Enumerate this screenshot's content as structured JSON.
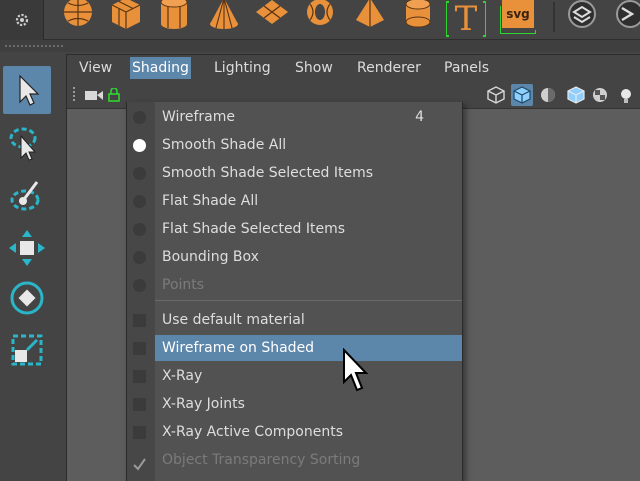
{
  "shelf": {
    "icons": [
      "sphere-icon",
      "cube-icon",
      "cylinder-icon",
      "cone-icon",
      "plane-icon",
      "torus-icon",
      "pyramid-icon",
      "disc-icon",
      "text-tool-icon",
      "svg-tool-icon",
      "sculpt-brush-icon",
      "nurbs-sphere-icon"
    ],
    "text_tool_glyph": "T",
    "svg_label": "svg",
    "accent_orange": "#e8913a",
    "accent_green": "#2fd52f"
  },
  "panel_menu": {
    "items": [
      "View",
      "Shading",
      "Lighting",
      "Show",
      "Renderer",
      "Panels"
    ],
    "open_index": 1
  },
  "shading_menu": {
    "items": [
      {
        "label": "Wireframe",
        "hotkey": "4",
        "mark": "radio",
        "checked": false,
        "disabled": false
      },
      {
        "label": "Smooth Shade All",
        "hotkey": "",
        "mark": "radio",
        "checked": true,
        "disabled": false
      },
      {
        "label": "Smooth Shade Selected Items",
        "hotkey": "",
        "mark": "radio",
        "checked": false,
        "disabled": false
      },
      {
        "label": "Flat Shade All",
        "hotkey": "",
        "mark": "radio",
        "checked": false,
        "disabled": false
      },
      {
        "label": "Flat Shade Selected Items",
        "hotkey": "",
        "mark": "radio",
        "checked": false,
        "disabled": false
      },
      {
        "label": "Bounding Box",
        "hotkey": "",
        "mark": "radio",
        "checked": false,
        "disabled": false
      },
      {
        "label": "Points",
        "hotkey": "",
        "mark": "radio",
        "checked": false,
        "disabled": true
      },
      {
        "label": "Use default material",
        "hotkey": "",
        "mark": "check",
        "checked": false,
        "disabled": false
      },
      {
        "label": "Wireframe on Shaded",
        "hotkey": "",
        "mark": "check",
        "checked": false,
        "disabled": false,
        "highlighted": true
      },
      {
        "label": "X-Ray",
        "hotkey": "",
        "mark": "check",
        "checked": false,
        "disabled": false
      },
      {
        "label": "X-Ray Joints",
        "hotkey": "",
        "mark": "check",
        "checked": false,
        "disabled": false
      },
      {
        "label": "X-Ray Active Components",
        "hotkey": "",
        "mark": "check",
        "checked": false,
        "disabled": false
      },
      {
        "label": "Object Transparency Sorting",
        "hotkey": "",
        "mark": "check",
        "checked": true,
        "disabled": true
      }
    ]
  },
  "colors": {
    "highlight": "#5d86ab",
    "menu_bg": "#525252",
    "panel_bg": "#5d5d5d"
  }
}
